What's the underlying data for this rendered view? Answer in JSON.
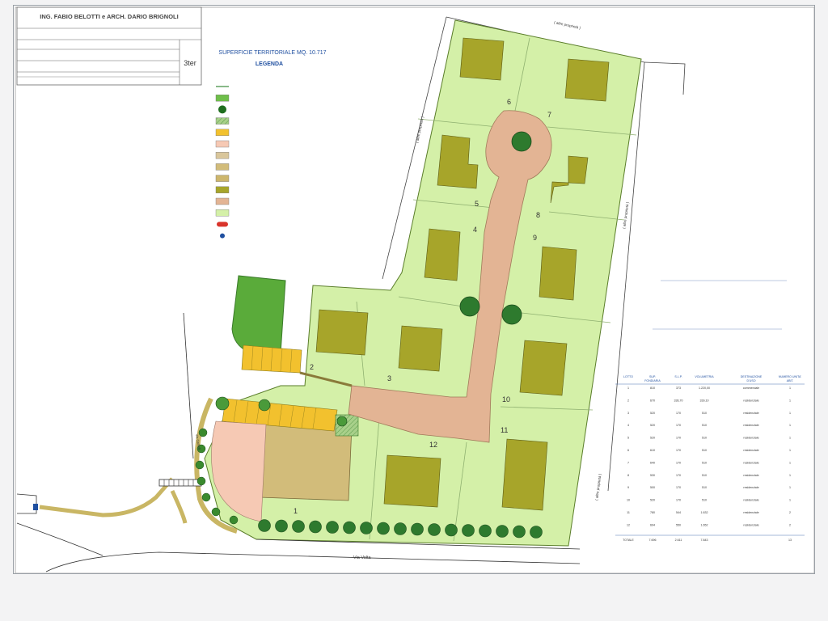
{
  "title_block": {
    "authors": "ING. FABIO BELOTTI e ARCH. DARIO BRIGNOLI",
    "office_address": "",
    "client": "",
    "project": "",
    "sheet_subject": "",
    "location": "",
    "sheet_number": "3ter"
  },
  "heading": {
    "surface": "SUPERFICIE TERRITORIALE MQ. 10.717",
    "legend_title": "LEGENDA"
  },
  "legend": [
    {
      "color": "#3a8a3a",
      "style": "line",
      "label": ""
    },
    {
      "color": "#6fbf4a",
      "style": "fill",
      "label": ""
    },
    {
      "color": "#1f6e1f",
      "style": "tree",
      "label": ""
    },
    {
      "color": "#a8d08a",
      "style": "hatch",
      "label": ""
    },
    {
      "color": "#f2c12e",
      "style": "fill",
      "label": ""
    },
    {
      "color": "#f6c9b4",
      "style": "fill",
      "label": ""
    },
    {
      "color": "#d9c69b",
      "style": "fill",
      "label": ""
    },
    {
      "color": "#d2bc7a",
      "style": "fill",
      "label": ""
    },
    {
      "color": "#cdb66c",
      "style": "fill",
      "label": ""
    },
    {
      "color": "#a7a52a",
      "style": "fill",
      "label": ""
    },
    {
      "color": "#e3b494",
      "style": "fill",
      "label": ""
    },
    {
      "color": "#d4f0a8",
      "style": "fill",
      "label": ""
    },
    {
      "color": "#d9342b",
      "style": "arrow",
      "label": ""
    },
    {
      "color": "#1f4fa0",
      "style": "dot",
      "label": ""
    }
  ],
  "plan_labels": {
    "street": "Via Volta",
    "side_street": "Via Castelli",
    "plaza": "",
    "boundary_top": "( altre proprietà )",
    "boundary_right": "( altre proprietà )",
    "boundary_left_top": "( altre proprietà )",
    "boundary_right_mid": "( altre proprietà )",
    "lots": [
      "1",
      "2",
      "3",
      "4",
      "5",
      "6",
      "7",
      "8",
      "9",
      "10",
      "11",
      "12"
    ]
  },
  "notes": {
    "note_top": "",
    "standards_title": "",
    "standards_lines": [],
    "urban_title": "",
    "urban_lines": []
  },
  "table": {
    "headers": [
      "LOTTO",
      "SUP. FONDIARIA",
      "S.L.P.",
      "VOLUMETRIA",
      "DESTINAZIONE D'USO",
      "NUMERO UNITA' ABIT."
    ],
    "rows": [
      [
        "1",
        "810",
        "373",
        "1.220,00",
        "commerciale",
        "1"
      ],
      [
        "2",
        "670",
        "336,70",
        "339,10",
        "residenziale",
        "1"
      ],
      [
        "3",
        "520",
        "170",
        "510",
        "residenziale",
        "1"
      ],
      [
        "4",
        "520",
        "170",
        "510",
        "residenziale",
        "1"
      ],
      [
        "5",
        "520",
        "170",
        "510",
        "residenziale",
        "1"
      ],
      [
        "6",
        "610",
        "170",
        "510",
        "residenziale",
        "1"
      ],
      [
        "7",
        "640",
        "170",
        "510",
        "residenziale",
        "1"
      ],
      [
        "8",
        "530",
        "170",
        "510",
        "residenziale",
        "1"
      ],
      [
        "9",
        "500",
        "170",
        "510",
        "residenziale",
        "1"
      ],
      [
        "10",
        "520",
        "170",
        "510",
        "residenziale",
        "1"
      ],
      [
        "11",
        "780",
        "544",
        "1.632",
        "residenziale",
        "2"
      ],
      [
        "12",
        "694",
        "550",
        "1.652",
        "residenziale",
        "2"
      ]
    ],
    "total": [
      "TOTALE",
      "7.696",
      "2.611",
      "7.843",
      "",
      "13"
    ]
  }
}
